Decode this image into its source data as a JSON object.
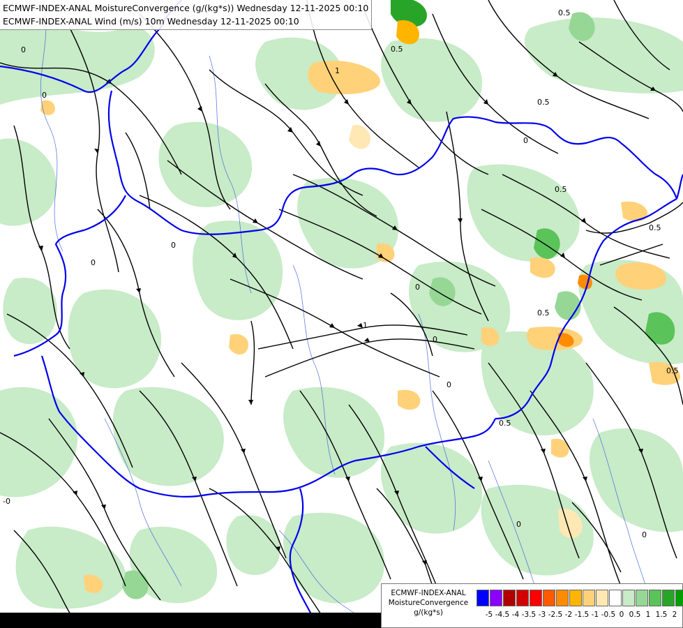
{
  "titles": {
    "line1": "ECMWF-INDEX-ANAL MoistureConvergence (g/(kg*s)) Wednesday 12-11-2025 00:10",
    "line2": "ECMWF-INDEX-ANAL Wind (m/s) 10m Wednesday 12-11-2025 00:10"
  },
  "legend": {
    "label_line1": "ECMWF-INDEX-ANAL",
    "label_line2": "MoistureConvergence",
    "label_line3": "g/(kg*s)",
    "colors": [
      "#0000ff",
      "#8b00ff",
      "#b00000",
      "#d20000",
      "#ff0000",
      "#ff5a00",
      "#ff8c00",
      "#ffb400",
      "#ffd27a",
      "#ffe8b4",
      "#ffffff",
      "#c8ebc8",
      "#96d796",
      "#5ac35a",
      "#28a528",
      "#00a000"
    ],
    "ticks": [
      "-5",
      "-4.5",
      "-4",
      "-3.5",
      "-3",
      "-2.5",
      "-2",
      "-1.5",
      "-1",
      "-0.5",
      "0",
      "0.5",
      "1",
      "1.5",
      "2"
    ]
  },
  "contour_labels": [
    "0",
    "0",
    "0",
    "0",
    "0",
    "0",
    "0",
    "0",
    "0",
    "0",
    "0.5",
    "0.5",
    "0.5",
    "0.5",
    "0.5",
    "0.5",
    "0.5",
    "0.5",
    "1",
    "1",
    "-0"
  ],
  "colors": {
    "border": "#0000ee",
    "river": "#3a5fd9",
    "streamline": "#000000",
    "convergence_green": "#c8ebc8",
    "convergence_green_dark": "#5ac35a",
    "divergence_orange": "#ffd27a"
  }
}
